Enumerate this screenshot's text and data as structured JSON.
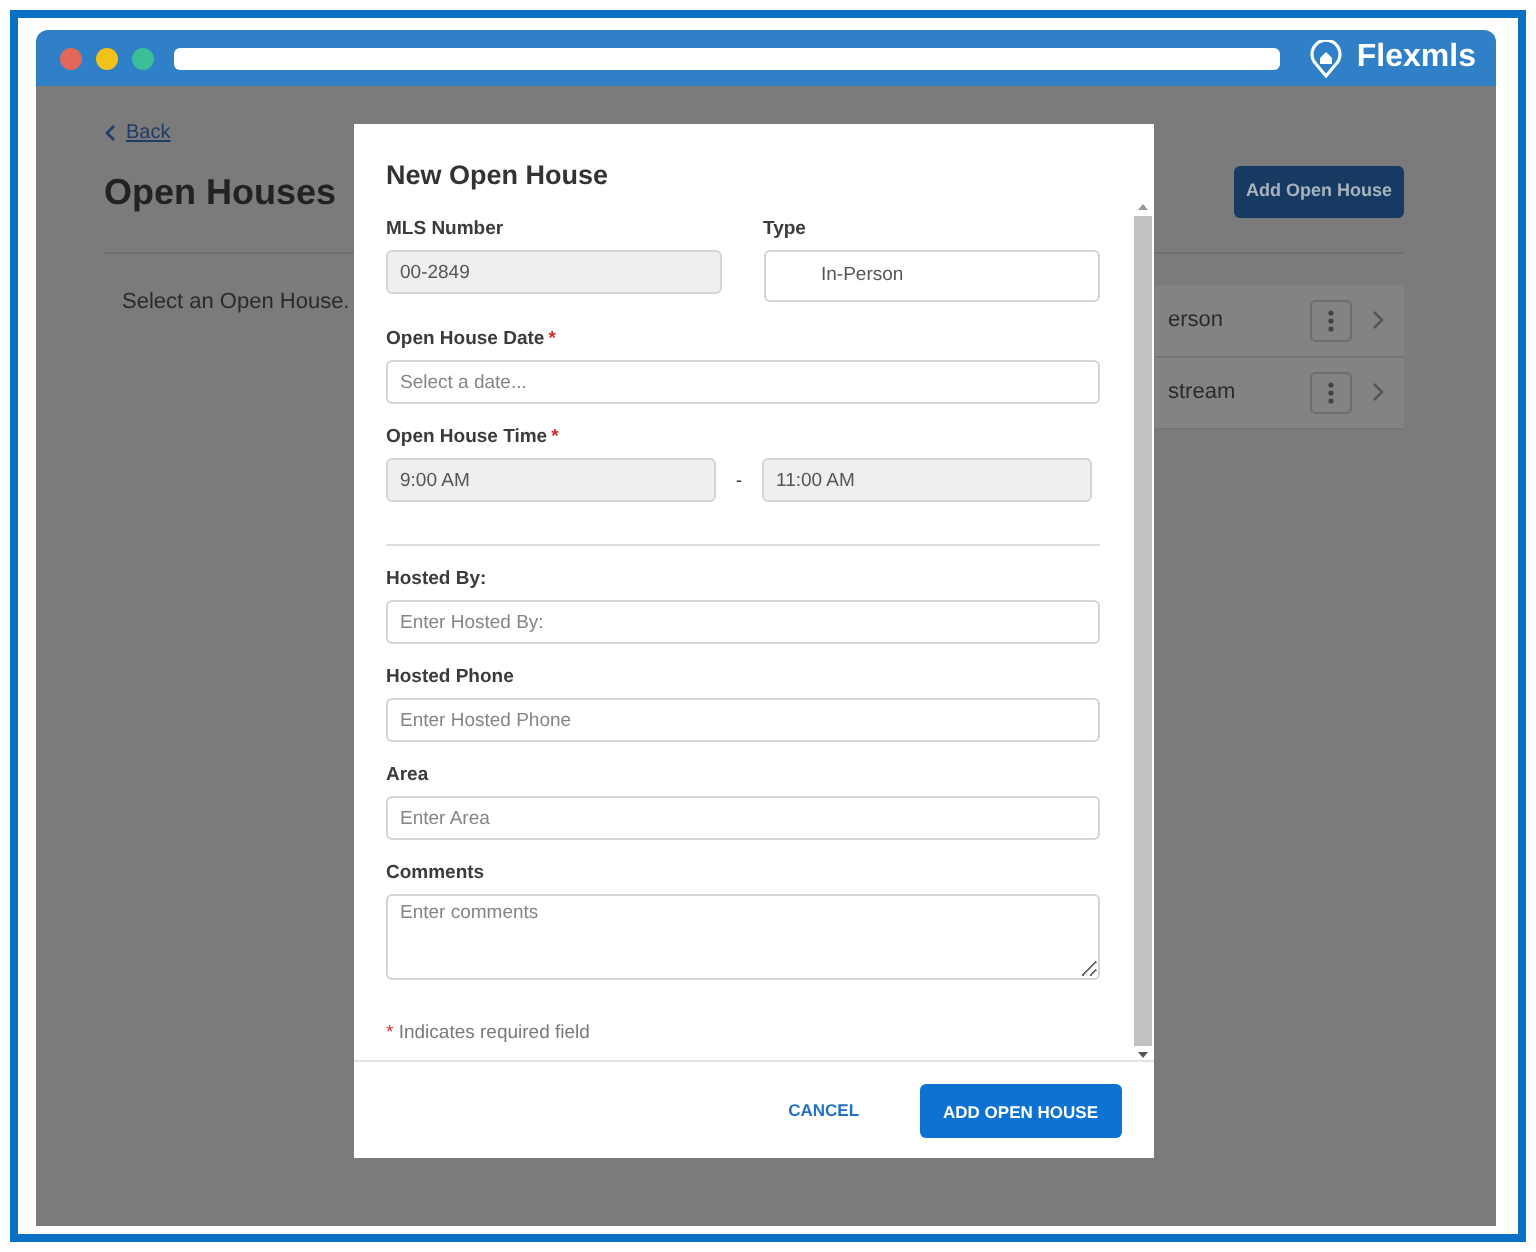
{
  "window": {
    "brand": "Flexmls"
  },
  "page": {
    "back": "Back",
    "title": "Open Houses",
    "add_button": "Add Open House",
    "empty_message": "Select an Open House.",
    "list_items": [
      {
        "label": "erson"
      },
      {
        "label": "stream"
      }
    ]
  },
  "modal": {
    "title": "New Open House",
    "rows": [
      {
        "fields": [
          {
            "kind": "input",
            "label": "MLS Number",
            "value": "00-2849",
            "disabled": true
          },
          {
            "kind": "select",
            "label": "Type",
            "value": "In-Person",
            "disabled": false
          }
        ]
      },
      {
        "fields": [
          {
            "kind": "input",
            "label": "Open House Date",
            "required_mark": "*",
            "placeholder": "Select a date...",
            "disabled": false
          }
        ]
      },
      {
        "fields": [
          {
            "kind": "range",
            "label": "Open House Time",
            "required_mark": "*",
            "values": [
              "9:00 AM",
              "11:00 AM"
            ],
            "separator": "-",
            "disabled": true
          }
        ]
      },
      {
        "fields": [
          {
            "kind": "divider"
          }
        ]
      },
      {
        "fields": [
          {
            "kind": "input",
            "label": "Hosted By:",
            "placeholder": "Enter Hosted By:",
            "disabled": false
          }
        ]
      },
      {
        "fields": [
          {
            "kind": "input",
            "label": "Hosted Phone",
            "placeholder": "Enter Hosted Phone",
            "disabled": false
          }
        ]
      },
      {
        "fields": [
          {
            "kind": "input",
            "label": "Area",
            "placeholder": "Enter Area",
            "disabled": false
          }
        ]
      },
      {
        "fields": [
          {
            "kind": "textarea",
            "label": "Comments",
            "placeholder": "Enter comments",
            "disabled": false
          }
        ]
      }
    ],
    "required_note": {
      "mark": "*",
      "text": "Indicates required field"
    },
    "buttons": [
      {
        "kind": "link",
        "label": "CANCEL"
      },
      {
        "kind": "primary",
        "label": "ADD OPEN HOUSE"
      }
    ]
  }
}
